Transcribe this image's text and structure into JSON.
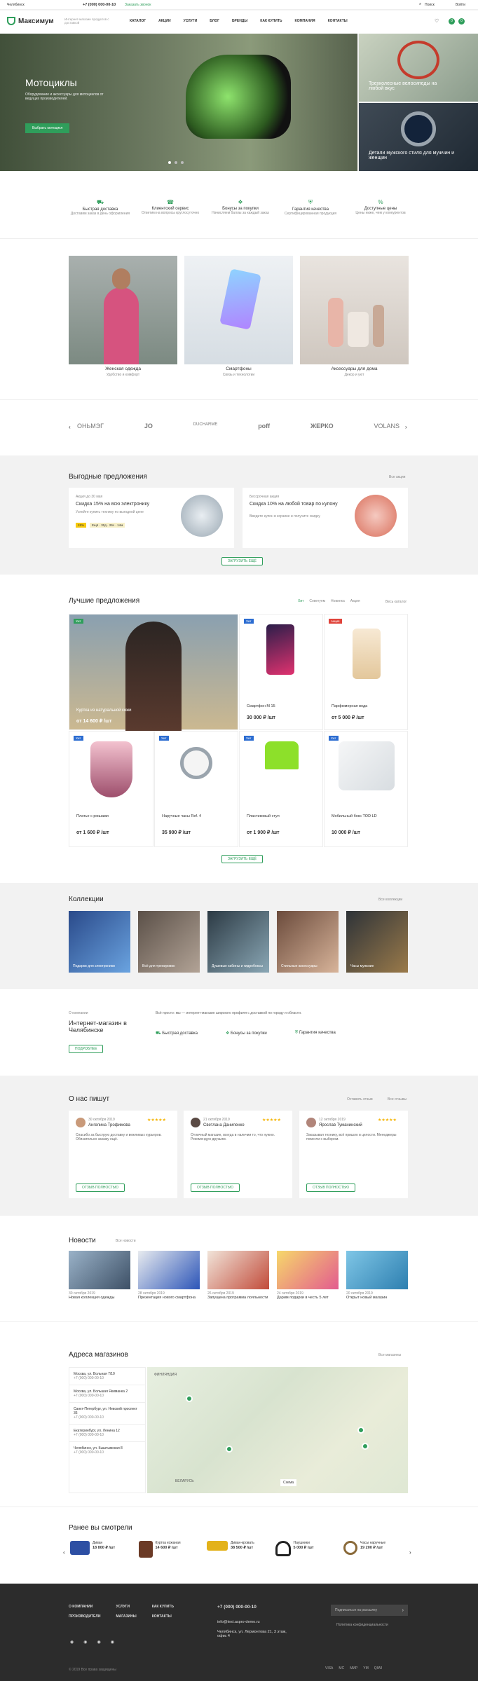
{
  "topbar": {
    "city": "Челябинск",
    "phone": "+7 (000) 000-00-10",
    "callback": "Заказать звонок",
    "search": "Поиск",
    "login": "Войти",
    "cart_count": "0",
    "compare_count": "0"
  },
  "header": {
    "logo": "Максимум",
    "tagline": "Интернет-магазин продуктов с доставкой",
    "nav": [
      "Каталог",
      "Акции",
      "Услуги",
      "Блог",
      "Бренды",
      "Как купить",
      "Компания",
      "Контакты"
    ]
  },
  "hero": {
    "title": "Мотоциклы",
    "text": "Оборудование и аксессуары для мотоциклов от ведущих производителей.",
    "button": "Выбрать мотоцикл",
    "side1": "Трехколесные велосипеды на любой вкус",
    "side2": "Детали мужского стиля для мужчин и женщин"
  },
  "features": [
    {
      "title": "Быстрая доставка",
      "text": "Доставим заказ в день оформления"
    },
    {
      "title": "Клиентский сервис",
      "text": "Ответим на вопросы круглосуточно"
    },
    {
      "title": "Бонусы за покупки",
      "text": "Начисляем баллы за каждый заказ"
    },
    {
      "title": "Гарантия качества",
      "text": "Сертифицированная продукция"
    },
    {
      "title": "Доступные цены",
      "text": "Цены ниже, чем у конкурентов"
    }
  ],
  "categories": [
    {
      "title": "Женская одежда",
      "sub": "Удобство и комфорт"
    },
    {
      "title": "Смартфоны",
      "sub": "Связь и технологии"
    },
    {
      "title": "Аксессуары для дома",
      "sub": "Декор и уют"
    }
  ],
  "brands": [
    "ОНЬМЭГ",
    "JO",
    "DUCHARME",
    "poff",
    "ЖЕРКО",
    "VOLANS"
  ],
  "offers": {
    "title": "Выгодные предложения",
    "all": "Все акции",
    "button": "Загрузить ещё",
    "items": [
      {
        "date": "Акция до 30 мая",
        "title": "Скидка 15% на всю электронику",
        "text": "Успейте купить технику по выгодной цене",
        "tags": [
          "15%",
          "Ещё · 30д · 26ч · 14м"
        ]
      },
      {
        "date": "Бессрочная акция",
        "title": "Скидка 10% на любой товар по купону",
        "text": "Введите купон в корзине и получите скидку"
      }
    ]
  },
  "best": {
    "title": "Лучшие предложения",
    "tabs": [
      "Хит",
      "Советуем",
      "Новинка",
      "Акция"
    ],
    "all": "Весь каталог",
    "button": "Загрузить ещё",
    "products": [
      {
        "name": "Куртка из натуральной кожи",
        "price": "от 14 600 ₽ /шт",
        "flag": "Хит"
      },
      {
        "name": "Смартфон M 15",
        "price": "30 000 ₽ /шт",
        "flag": "Хит"
      },
      {
        "name": "Парфюмерная вода",
        "price": "от 5 000 ₽ /шт",
        "flag": "Акция"
      },
      {
        "name": "Платье с рюшами",
        "price": "от 1 600 ₽ /шт",
        "flag": "Хит"
      },
      {
        "name": "Наручные часы Ref. 4",
        "price": "35 900 ₽ /шт",
        "flag": "Хит"
      },
      {
        "name": "Пластиковый стул",
        "price": "от 1 900 ₽ /шт",
        "flag": "Хит"
      },
      {
        "name": "Мобильный бокс TOD LD",
        "price": "10 000 ₽ /шт",
        "flag": "Хит"
      }
    ]
  },
  "collections": {
    "title": "Коллекции",
    "all": "Все коллекции",
    "items": [
      "Подарки для электроники",
      "Всё для тренировок",
      "Душевые кабины и гидробоксы",
      "Стильные аксессуары",
      "Часы мужские"
    ]
  },
  "about": {
    "label": "О компании",
    "title": "Интернет-магазин в Челябинске",
    "button": "Подробнее",
    "text": "Всё просто: мы — интернет-магазин широкого профиля с доставкой по городу и области.",
    "points": [
      "Быстрая доставка",
      "Бонусы за покупки",
      "Гарантия качества"
    ]
  },
  "reviews": {
    "title": "О нас пишут",
    "leave": "Оставить отзыв",
    "all": "Все отзывы",
    "btn": "Отзыв полностью",
    "items": [
      {
        "name": "Ангелина Трофимова",
        "date": "30 октября 2019",
        "text": "Спасибо за быструю доставку и вежливых курьеров. Обязательно закажу ещё."
      },
      {
        "name": "Светлана Даниленко",
        "date": "21 октября 2019",
        "text": "Отличный магазин, всегда в наличии то, что нужно. Рекомендую друзьям."
      },
      {
        "name": "Ярослав Туманинский",
        "date": "12 октября 2019",
        "text": "Заказывал технику, всё пришло в целости. Менеджеры помогли с выбором."
      }
    ]
  },
  "news": {
    "title": "Новости",
    "link": "Все новости",
    "items": [
      {
        "date": "30 октября 2019",
        "title": "Новая коллекция одежды"
      },
      {
        "date": "28 октября 2019",
        "title": "Презентация нового смартфона"
      },
      {
        "date": "26 октября 2019",
        "title": "Запущена программа лояльности"
      },
      {
        "date": "24 октября 2019",
        "title": "Дарим подарки в честь 5 лет"
      },
      {
        "date": "20 октября 2019",
        "title": "Открыт новый магазин"
      }
    ]
  },
  "stores": {
    "title": "Адреса магазинов",
    "all": "Все магазины",
    "items": [
      {
        "addr": "Москва, ул. Вольная 7/10",
        "phone": "+7 (000) 000-00-10"
      },
      {
        "addr": "Москва, ул. Большая Якиманка 2",
        "phone": "+7 (000) 000-00-10"
      },
      {
        "addr": "Санкт-Петербург, ул. Невский проспект 36",
        "phone": "+7 (000) 000-00-10"
      },
      {
        "addr": "Екатеринбург, ул. Ленина 12",
        "phone": "+7 (000) 000-00-10"
      },
      {
        "addr": "Челябинск, ул. Кыштымская 8",
        "phone": "+7 (000) 000-00-10"
      }
    ],
    "map_label": "ФИНЛЯНДИЯ",
    "map_label2": "БЕЛАРУСЬ",
    "scale": "Схема"
  },
  "viewed": {
    "title": "Ранее вы смотрели",
    "items": [
      {
        "name": "Диван",
        "price": "18 800 ₽ /шт"
      },
      {
        "name": "Куртка кожаная",
        "price": "14 600 ₽ /шт"
      },
      {
        "name": "Диван-кровать",
        "price": "38 500 ₽ /шт"
      },
      {
        "name": "Наушники",
        "price": "5 000 ₽ /шт"
      },
      {
        "name": "Часы наручные",
        "price": "19 200 ₽ /шт"
      }
    ]
  },
  "footer": {
    "links": [
      "О компании",
      "Услуги",
      "Как купить",
      "Производители",
      "Магазины",
      "Контакты"
    ],
    "phone": "+7 (000) 000-00-10",
    "email": "info@test.aspro-demo.ru",
    "address": "Челябинск, ул. Лермонтова 21, 3 этаж, офис 4",
    "subscribe": "Подписаться на рассылку",
    "policy": "Политика конфиденциальности",
    "copyright": "© 2019 Все права защищены",
    "payments": [
      "VISA",
      "MC",
      "МИР",
      "YM",
      "QIWI"
    ]
  }
}
